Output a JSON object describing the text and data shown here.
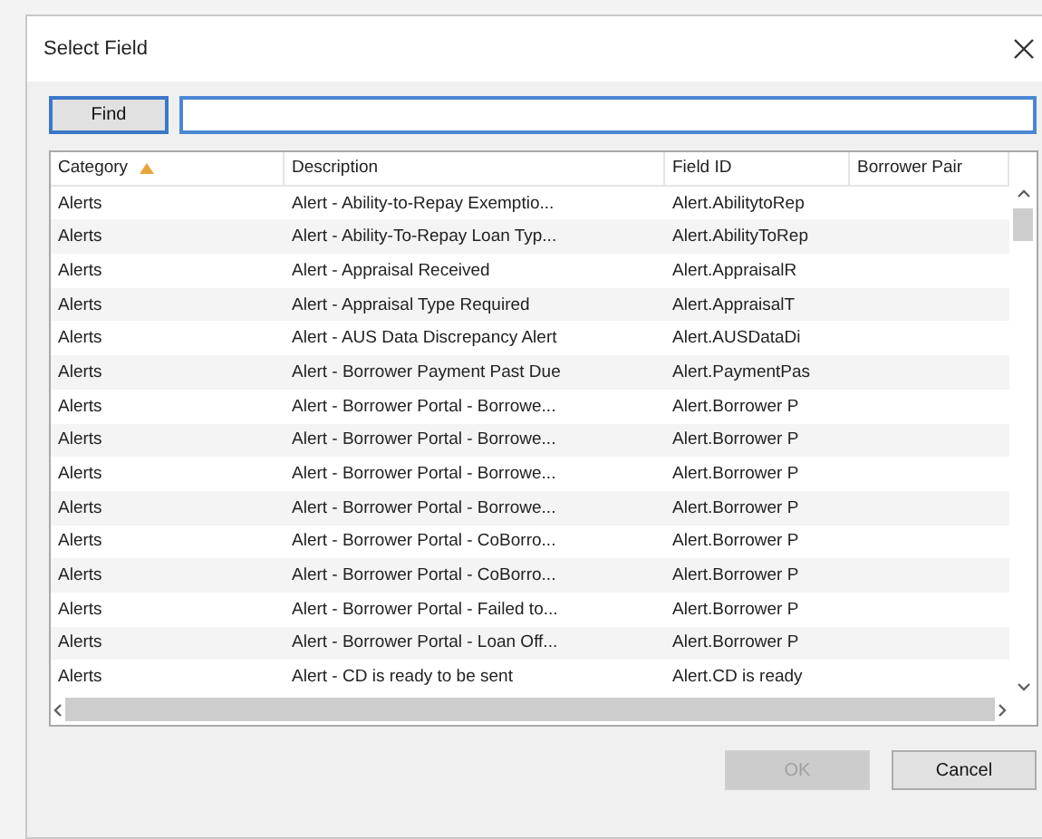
{
  "window": {
    "title": "Select Field"
  },
  "find_button": {
    "label": "Find"
  },
  "table": {
    "columns": [
      {
        "label": "Category",
        "sorted": true
      },
      {
        "label": "Description",
        "sorted": false
      },
      {
        "label": "Field ID",
        "sorted": false
      },
      {
        "label": "Borrower Pair",
        "sorted": false
      }
    ],
    "rows": [
      {
        "cells": [
          "Alerts",
          "Alert - Ability-to-Repay Exemptio...",
          "Alert.AbilitytoRep"
        ]
      },
      {
        "cells": [
          "Alerts",
          "Alert - Ability-To-Repay Loan Typ...",
          "Alert.AbilityToRep"
        ]
      },
      {
        "cells": [
          "Alerts",
          "Alert - Appraisal Received",
          "Alert.AppraisalR"
        ]
      },
      {
        "cells": [
          "Alerts",
          "Alert - Appraisal Type Required",
          "Alert.AppraisalT"
        ]
      },
      {
        "cells": [
          "Alerts",
          "Alert - AUS Data Discrepancy Alert",
          "Alert.AUSDataDi"
        ]
      },
      {
        "cells": [
          "Alerts",
          "Alert - Borrower Payment Past Due",
          "Alert.PaymentPas"
        ]
      },
      {
        "cells": [
          "Alerts",
          "Alert - Borrower Portal - Borrowe...",
          "Alert.Borrower P"
        ]
      },
      {
        "cells": [
          "Alerts",
          "Alert - Borrower Portal - Borrowe...",
          "Alert.Borrower P"
        ]
      },
      {
        "cells": [
          "Alerts",
          "Alert - Borrower Portal - Borrowe...",
          "Alert.Borrower P"
        ]
      },
      {
        "cells": [
          "Alerts",
          "Alert - Borrower Portal - Borrowe...",
          "Alert.Borrower P"
        ]
      },
      {
        "cells": [
          "Alerts",
          "Alert - Borrower Portal - CoBorro...",
          "Alert.Borrower P"
        ]
      },
      {
        "cells": [
          "Alerts",
          "Alert - Borrower Portal - CoBorro...",
          "Alert.Borrower P"
        ]
      },
      {
        "cells": [
          "Alerts",
          "Alert - Borrower Portal - Failed to...",
          "Alert.Borrower P"
        ]
      },
      {
        "cells": [
          "Alerts",
          "Alert - Borrower Portal - Loan Off...",
          "Alert.Borrower P"
        ]
      },
      {
        "cells": [
          "Alerts",
          "Alert - CD is ready to be sent",
          "Alert.CD is ready"
        ]
      }
    ]
  },
  "buttons": [
    {
      "label": "OK",
      "disabled": true
    },
    {
      "label": "Cancel",
      "disabled": false
    }
  ]
}
